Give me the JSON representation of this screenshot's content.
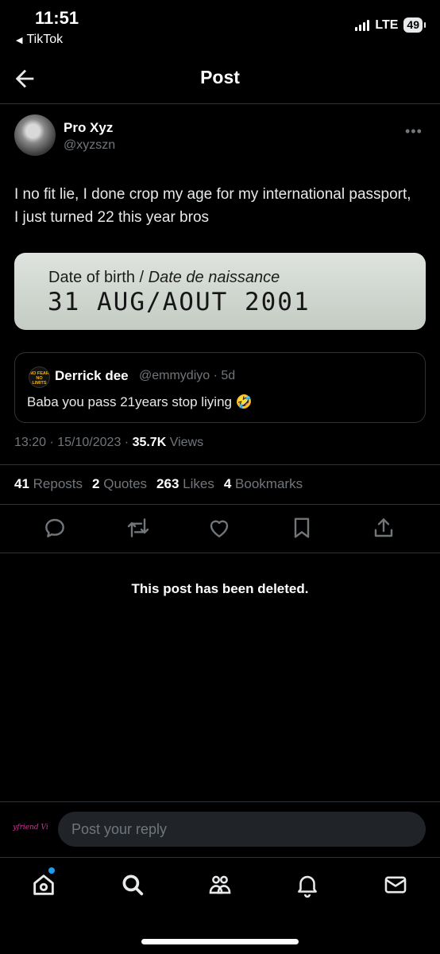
{
  "status_bar": {
    "time": "11:51",
    "back_app": "TikTok",
    "network": "LTE",
    "battery": "49"
  },
  "header": {
    "title": "Post"
  },
  "post": {
    "author_name": "Pro Xyz",
    "author_handle": "@xyzszn",
    "text": "I no fit lie, I done crop my age for my international passport, I just turned 22 this year bros",
    "media": {
      "label_en": "Date of birth",
      "label_sep": " / ",
      "label_fr": "Date de naissance",
      "value": "31 AUG/AOUT 2001"
    },
    "quote": {
      "author_name": "Derrick dee",
      "meta": "@emmydiyo · 5d",
      "text": "Baba you pass 21years stop liying 🤣",
      "avatar_text": "NO FEAR NO LIMITS"
    },
    "timestamp": "13:20 · 15/10/2023 · ",
    "views_count": "35.7K",
    "views_label": " Views",
    "stats": [
      {
        "count": "41",
        "label": "Reposts"
      },
      {
        "count": "2",
        "label": "Quotes"
      },
      {
        "count": "263",
        "label": "Likes"
      },
      {
        "count": "4",
        "label": "Bookmarks"
      }
    ]
  },
  "deleted_notice": "This post has been deleted.",
  "reply": {
    "placeholder": "Post your reply",
    "avatar_text": "Boyfriend Ville"
  },
  "colors": {
    "background": "#000000",
    "text": "#e7e9ea",
    "muted": "#71767b",
    "divider": "#2f3336",
    "accent": "#1d9bf0"
  },
  "icons": {
    "back": "arrow-left-icon",
    "actions": [
      "reply-icon",
      "repost-icon",
      "like-icon",
      "bookmark-icon",
      "share-icon"
    ],
    "nav": [
      "home-icon",
      "search-icon",
      "communities-icon",
      "notifications-icon",
      "messages-icon"
    ]
  }
}
